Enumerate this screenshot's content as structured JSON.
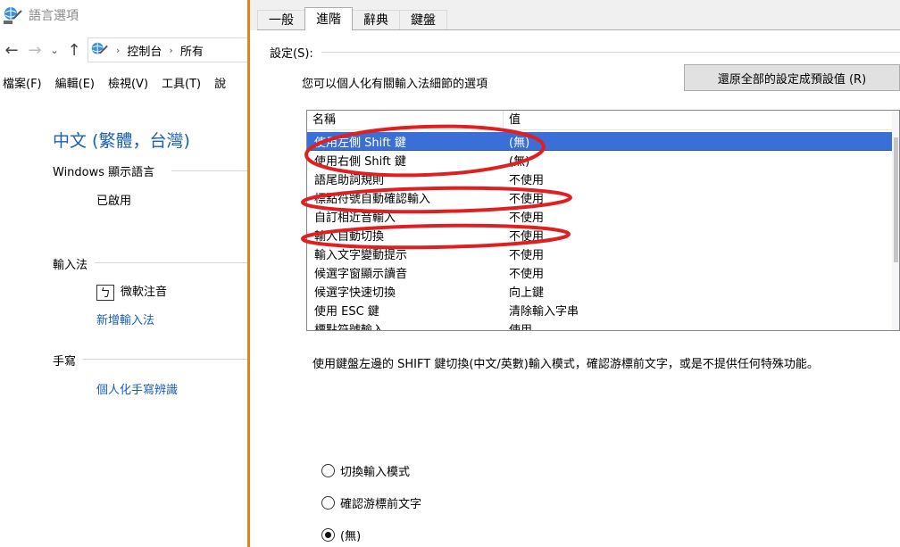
{
  "left_window": {
    "title": "語言選項",
    "address": {
      "crumbs": [
        "控制台",
        "所有"
      ]
    },
    "menu": [
      "檔案(F)",
      "編輯(E)",
      "檢視(V)",
      "工具(T)",
      "說"
    ],
    "heading": "中文 (繁體，台灣)",
    "display_language": {
      "label": "Windows 顯示語言",
      "value": "已啟用"
    },
    "input_method": {
      "label": "輸入法",
      "ime_glyph": "ㄅ",
      "ime_name": "微軟注音",
      "add_link": "新增輸入法"
    },
    "handwriting": {
      "label": "手寫",
      "link": "個人化手寫辨識"
    }
  },
  "dialog": {
    "tabs": [
      "一般",
      "進階",
      "辭典",
      "鍵盤"
    ],
    "active_tab": "進階",
    "settings_label": "設定(S):",
    "description": "您可以個人化有關輸入法細節的選項",
    "reset_button": "還原全部的設定成預設值 (R)",
    "columns": [
      "名稱",
      "值"
    ],
    "rows": [
      {
        "name": "使用左側 Shift 鍵",
        "value": "(無)",
        "selected": true
      },
      {
        "name": "使用右側 Shift 鍵",
        "value": "(無)"
      },
      {
        "name": "語尾助詞規則",
        "value": "不使用"
      },
      {
        "name": "標點符號自動確認輸入",
        "value": "不使用"
      },
      {
        "name": "自訂相近音輸入",
        "value": "不使用"
      },
      {
        "name": "輸入自動切換",
        "value": "不使用"
      },
      {
        "name": "輸入文字變動提示",
        "value": "不使用"
      },
      {
        "name": "候選字窗顯示讀音",
        "value": "不使用"
      },
      {
        "name": "候選字快速切換",
        "value": "向上鍵"
      },
      {
        "name": "使用 ESC 鍵",
        "value": "清除輸入字串"
      },
      {
        "name": "標點符號輸入",
        "value": "使用"
      }
    ],
    "explanation": "使用鍵盤左邊的 SHIFT 鍵切換(中文/英數)輸入模式，確認游標前文字，或是不提供任何特殊功能。",
    "options": [
      {
        "label": "切換輸入模式",
        "checked": false
      },
      {
        "label": "確認游標前文字",
        "checked": false
      },
      {
        "label": "(無)",
        "checked": true
      }
    ]
  },
  "colors": {
    "link": "#1a5fb4",
    "selection": "#3a6fd8",
    "annotation": "#e02020",
    "divider": "#e67e22"
  },
  "icons": [
    "globe-keyboard-icon",
    "back-arrow-icon",
    "forward-arrow-icon",
    "recent-dropdown-icon",
    "up-arrow-icon",
    "chevron-right-icon"
  ]
}
